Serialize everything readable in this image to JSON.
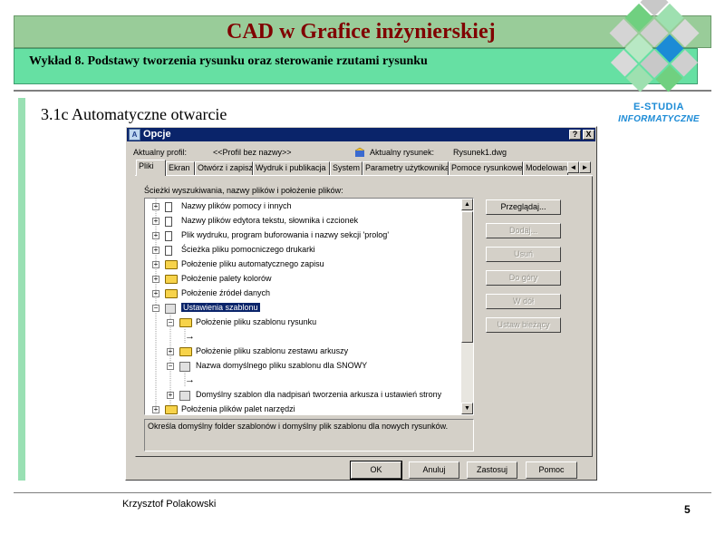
{
  "slide": {
    "title": "CAD w Grafice inżynierskiej",
    "subtitle": "Wykład 8.  Podstawy tworzenia rysunku oraz sterowanie rzutami rysunku",
    "section": "3.1c Automatyczne otwarcie",
    "author": "Krzysztof Polakowski",
    "page": "5",
    "logo_line1": "E-STUDIA",
    "logo_line2": "INFORMATYCZNE"
  },
  "colors": {
    "title_band": "#99cc99",
    "subtitle_band": "#66e0a3",
    "title_text": "#800000",
    "logo_blue": "#1c8bd6",
    "dialog_titlebar": "#0a246a"
  },
  "dialog": {
    "title": "Opcje",
    "help_button": "?",
    "close_button": "X",
    "profile_label": "Aktualny profil:",
    "profile_value": "<<Profil bez nazwy>>",
    "drawing_label": "Aktualny rysunek:",
    "drawing_value": "Rysunek1.dwg",
    "tabs": [
      "Pliki",
      "Ekran",
      "Otwórz i zapisz",
      "Wydruk i publikacja",
      "System",
      "Parametry użytkownika",
      "Pomoce rysunkowe",
      "Modelowan"
    ],
    "active_tab": "Pliki",
    "tab_scroll_left": "◄",
    "tab_scroll_right": "►",
    "section_label": "Ścieżki wyszukiwania, nazwy plików i położenie plików:",
    "tree": [
      {
        "label": "Nazwy plików pomocy i innych",
        "icon": "doc-icon",
        "expander": "+"
      },
      {
        "label": "Nazwy plików edytora tekstu, słownika i czcionek",
        "icon": "doc-icon",
        "expander": "+"
      },
      {
        "label": "Plik wydruku, program buforowania i nazwy sekcji 'prolog'",
        "icon": "doc-icon",
        "expander": "+"
      },
      {
        "label": "Ścieżka pliku pomocniczego drukarki",
        "icon": "doc-icon",
        "expander": "+"
      },
      {
        "label": "Położenie pliku automatycznego zapisu",
        "icon": "folder-icon",
        "expander": "+"
      },
      {
        "label": "Położenie palety kolorów",
        "icon": "folder-icon",
        "expander": "+"
      },
      {
        "label": "Położenie źródeł danych",
        "icon": "folder-icon",
        "expander": "+"
      },
      {
        "label": "Ustawienia szablonu",
        "icon": "template-settings-icon",
        "expander": "−",
        "selected": true
      },
      {
        "label": "Położenie pliku szablonu rysunku",
        "icon": "folder-icon",
        "expander": "−"
      },
      {
        "label": "",
        "icon": "arrow-icon",
        "expander": ""
      },
      {
        "label": "Położenie pliku szablonu zestawu arkuszy",
        "icon": "folder-icon",
        "expander": "+"
      },
      {
        "label": "Nazwa domyślnego pliku szablonu dla SNOWY",
        "icon": "template-icon",
        "expander": "−"
      },
      {
        "label": "",
        "icon": "arrow-icon",
        "expander": ""
      },
      {
        "label": "Domyślny szablon dla nadpisań tworzenia arkusza i ustawień strony",
        "icon": "template-icon",
        "expander": "+"
      },
      {
        "label": "Położenia plików palet narzędzi",
        "icon": "folder-icon",
        "expander": "+"
      }
    ],
    "description": "Określa domyślny folder szablonów i domyślny plik szablonu dla nowych rysunków.",
    "side_buttons": [
      {
        "label": "Przeglądaj...",
        "enabled": true
      },
      {
        "label": "Dodaj...",
        "enabled": false
      },
      {
        "label": "Usuń",
        "enabled": false
      },
      {
        "label": "Do góry",
        "enabled": false
      },
      {
        "label": "W dół",
        "enabled": false
      },
      {
        "label": "Ustaw bieżący",
        "enabled": false
      }
    ],
    "bottom_buttons": {
      "ok": "OK",
      "cancel": "Anuluj",
      "apply": "Zastosuj",
      "help": "Pomoc"
    }
  }
}
